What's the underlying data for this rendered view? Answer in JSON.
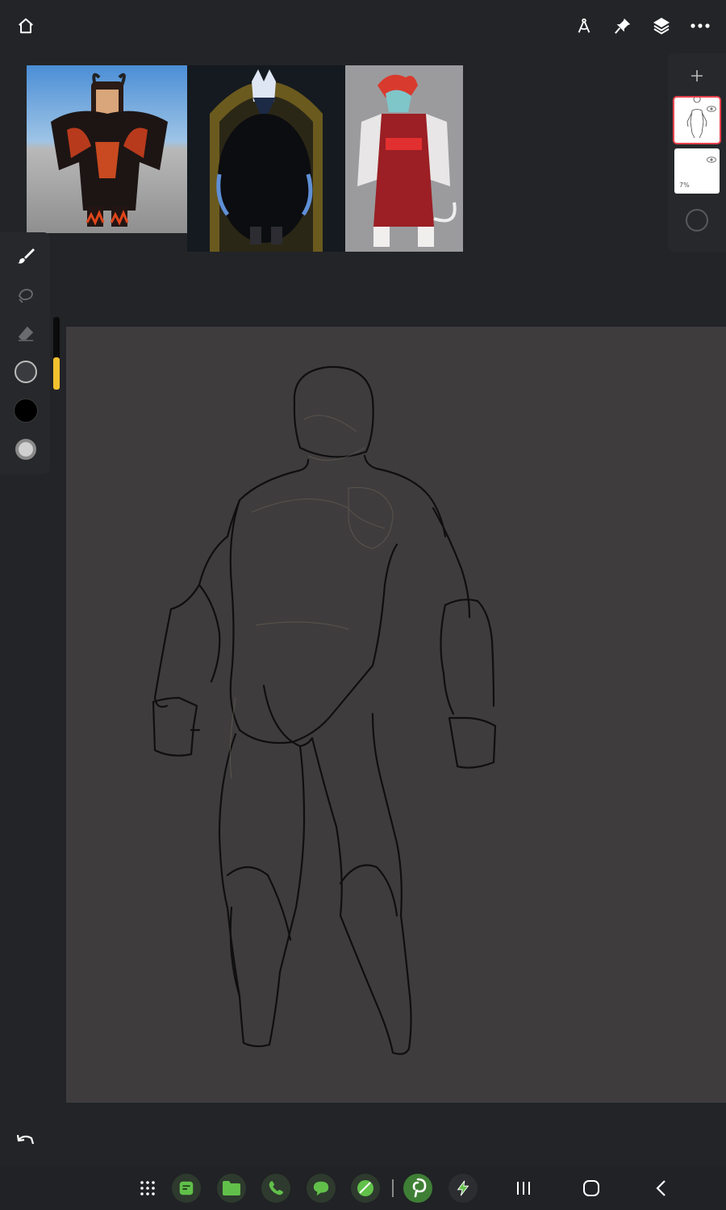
{
  "app": {
    "name": "drawing-canvas"
  },
  "topbar": {
    "icons": [
      "home-icon",
      "ruler-compass-icon",
      "pin-icon",
      "layers-icon",
      "more-icon"
    ]
  },
  "references": [
    {
      "name": "reference-image-1",
      "description_icon": "roblox-avatar"
    },
    {
      "name": "reference-image-2",
      "description_icon": "dark-wolf-character"
    },
    {
      "name": "reference-image-3",
      "description_icon": "red-coat-character"
    }
  ],
  "layers": {
    "add_icon": "plus-icon",
    "items": [
      {
        "name": "layer-1",
        "selected": true,
        "visible": true,
        "opacity_label": ""
      },
      {
        "name": "layer-2",
        "selected": false,
        "visible": true,
        "opacity_label": "7%"
      }
    ]
  },
  "tools": {
    "items": [
      "brush-icon",
      "smudge-icon",
      "eraser-icon",
      "brush-size-icon",
      "color-swatch",
      "opacity-icon"
    ],
    "active_color": "#000000",
    "size_slider_fraction": 0.45
  },
  "colors": {
    "background": "#222427",
    "canvas": "#3f3c3e",
    "selection": "#e8414e",
    "slider": "#f2c12e"
  },
  "bottom_nav": {
    "apps": [
      "app-drawer-icon",
      "notes-app-icon",
      "files-app-icon",
      "phone-app-icon",
      "messages-app-icon",
      "gallery-app-icon",
      "pinterest-app-icon",
      "power-app-icon"
    ],
    "system": [
      "recents-icon",
      "home-button-icon",
      "back-icon"
    ]
  }
}
